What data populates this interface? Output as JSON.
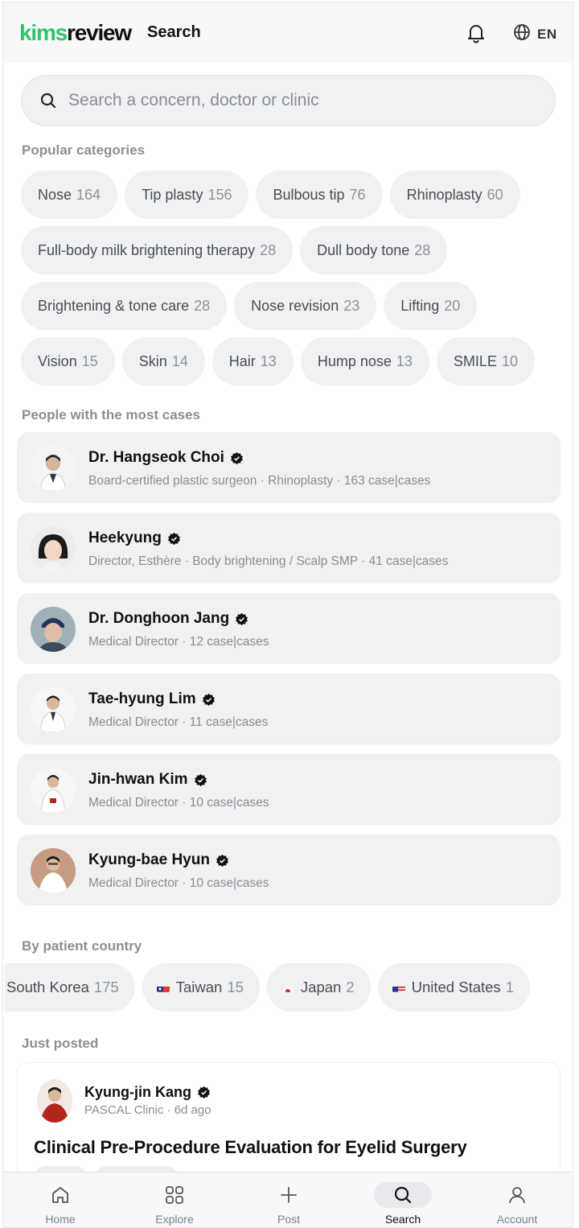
{
  "header": {
    "logo_part1": "kims",
    "logo_part2": "review",
    "title": "Search",
    "bell_icon": "bell-icon",
    "globe_icon": "globe-icon",
    "language": "EN"
  },
  "search": {
    "placeholder": "Search a concern, doctor or clinic",
    "icon": "search-icon"
  },
  "categories": {
    "title": "Popular categories",
    "items": [
      {
        "label": "Nose",
        "count": "164"
      },
      {
        "label": "Tip plasty",
        "count": "156"
      },
      {
        "label": "Bulbous tip",
        "count": "76"
      },
      {
        "label": "Rhinoplasty",
        "count": "60"
      },
      {
        "label": "Full-body milk brightening therapy",
        "count": "28"
      },
      {
        "label": "Dull body tone",
        "count": "28"
      },
      {
        "label": "Brightening & tone care",
        "count": "28"
      },
      {
        "label": "Nose revision",
        "count": "23"
      },
      {
        "label": "Lifting",
        "count": "20"
      },
      {
        "label": "Vision",
        "count": "15"
      },
      {
        "label": "Skin",
        "count": "14"
      },
      {
        "label": "Hair",
        "count": "13"
      },
      {
        "label": "Hump nose",
        "count": "13"
      },
      {
        "label": "SMILE",
        "count": "10"
      }
    ]
  },
  "people": {
    "title": "People with the most cases",
    "items": [
      {
        "name": "Dr. Hangseok Choi",
        "subtitle": "Board-certified plastic surgeon · Rhinoplasty · 163 case|cases"
      },
      {
        "name": "Heekyung",
        "subtitle": "Director, Esthère · Body brightening / Scalp SMP · 41 case|cases"
      },
      {
        "name": "Dr. Donghoon Jang",
        "subtitle": "Medical Director · 12 case|cases"
      },
      {
        "name": "Tae-hyung Lim",
        "subtitle": "Medical Director · 11 case|cases"
      },
      {
        "name": "Jin-hwan Kim",
        "subtitle": "Medical Director · 10 case|cases"
      },
      {
        "name": "Kyung-bae Hyun",
        "subtitle": "Medical Director · 10 case|cases"
      }
    ]
  },
  "countries": {
    "title": "By patient country",
    "items": [
      {
        "label": "South Korea",
        "count": "175",
        "flag": "kr"
      },
      {
        "label": "Taiwan",
        "count": "15",
        "flag": "tw"
      },
      {
        "label": "Japan",
        "count": "2",
        "flag": "jp"
      },
      {
        "label": "United States",
        "count": "1",
        "flag": "us"
      }
    ]
  },
  "just_posted": {
    "title": "Just posted",
    "post": {
      "author": "Kyung-jin Kang",
      "meta": "PASCAL Clinic · 6d ago",
      "title": "Clinical Pre-Procedure Evaluation for Eyelid Surgery"
    }
  },
  "nav": {
    "items": [
      {
        "label": "Home",
        "icon": "home-icon"
      },
      {
        "label": "Explore",
        "icon": "grid-icon"
      },
      {
        "label": "Post",
        "icon": "plus-icon"
      },
      {
        "label": "Search",
        "icon": "search-icon"
      },
      {
        "label": "Account",
        "icon": "user-icon"
      }
    ],
    "active": "Search"
  },
  "colors": {
    "brand_green": "#2fc46a",
    "chip_bg": "#f0f1f3",
    "muted_text": "#8a8d93"
  }
}
